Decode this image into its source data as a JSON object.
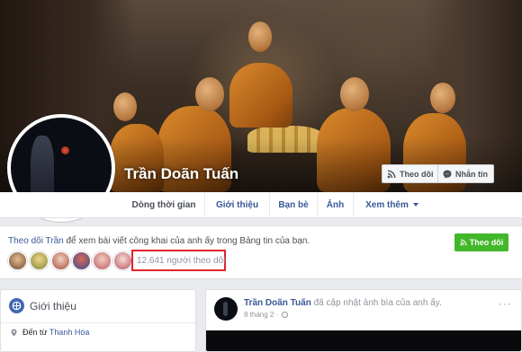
{
  "profile": {
    "name": "Trần Doãn Tuấn"
  },
  "cover_buttons": {
    "follow_label": "Theo dõi",
    "message_label": "Nhắn tin"
  },
  "nav": {
    "tabs": [
      {
        "label": "Dòng thời gian"
      },
      {
        "label": "Giới thiệu"
      },
      {
        "label": "Bạn bè"
      },
      {
        "label": "Ảnh"
      },
      {
        "label": "Xem thêm"
      }
    ]
  },
  "follow_card": {
    "link_text": "Theo dõi Trần",
    "rest_text": " để xem bài viết công khai của anh ấy trong Bảng tin của bạn.",
    "followers_count": "12.641 người theo dõi",
    "button_label": "Theo dõi",
    "accent_color": "#42b72a",
    "highlight_color": "#e0242c"
  },
  "intro": {
    "title": "Giới thiệu",
    "from_label": "Đến từ ",
    "from_place": "Thanh Hóa"
  },
  "post": {
    "author": "Trần Doãn Tuấn",
    "action": " đã cập nhật ảnh bìa của anh ấy.",
    "date": "8 tháng 2",
    "menu": "···"
  },
  "icons": {
    "follow": "rss-icon",
    "message": "messenger-icon",
    "location": "map-pin-icon",
    "privacy": "globe-icon",
    "intro": "globe-info-icon"
  },
  "colors": {
    "link": "#385898",
    "page_bg": "#e9ebee"
  }
}
